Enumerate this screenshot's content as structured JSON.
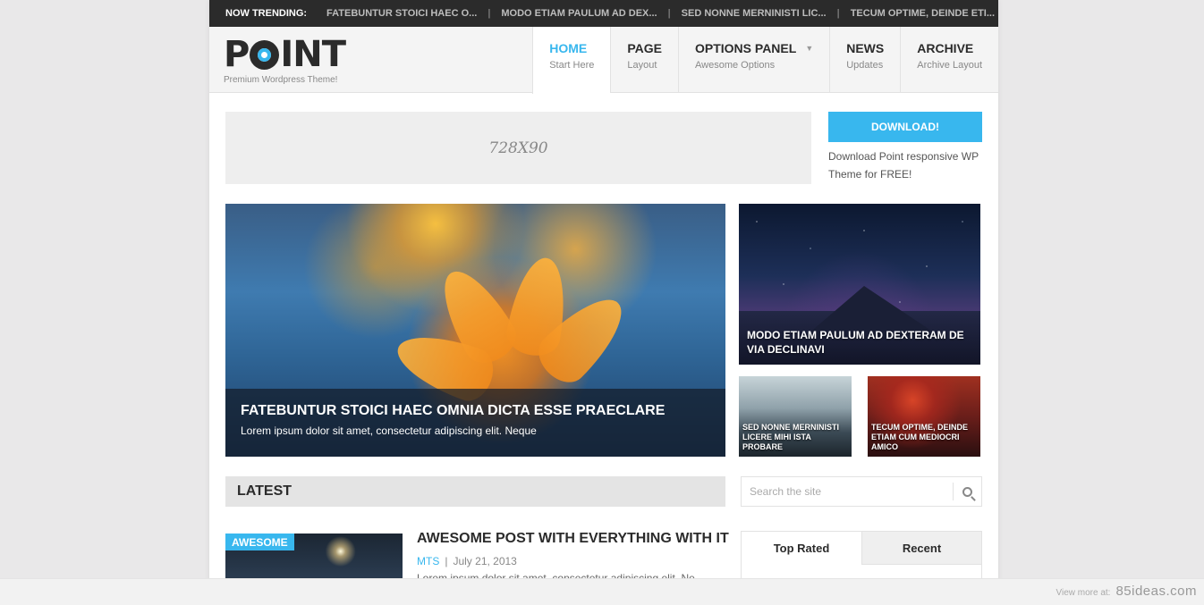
{
  "trending": {
    "label": "NOW TRENDING:",
    "items": [
      "FATEBUNTUR STOICI HAEC O...",
      "MODO ETIAM PAULUM AD DEX...",
      "SED NONNE MERNINISTI LIC...",
      "TECUM OPTIME, DEINDE ETI..."
    ]
  },
  "logo": {
    "text_pre": "P",
    "text_post": "INT",
    "tagline": "Premium Wordpress Theme!"
  },
  "nav": [
    {
      "title": "HOME",
      "sub": "Start Here",
      "active": true
    },
    {
      "title": "PAGE",
      "sub": "Layout"
    },
    {
      "title": "OPTIONS PANEL",
      "sub": "Awesome Options",
      "dropdown": true
    },
    {
      "title": "NEWS",
      "sub": "Updates"
    },
    {
      "title": "ARCHIVE",
      "sub": "Archive Layout"
    }
  ],
  "ad": {
    "label": "728X90"
  },
  "download": {
    "button": "DOWNLOAD!",
    "text": "Download Point responsive WP Theme for FREE!"
  },
  "featured": {
    "main": {
      "title": "FATEBUNTUR STOICI HAEC OMNIA DICTA ESSE PRAECLARE",
      "excerpt": "Lorem ipsum dolor sit amet, consectetur adipiscing elit. Neque"
    },
    "right_top": {
      "title": "MODO ETIAM PAULUM AD DEXTERAM DE VIA DECLINAVI"
    },
    "right_bottom_left": {
      "title": "SED NONNE MERNINISTI LICERE MIHI ISTA PROBARE"
    },
    "right_bottom_right": {
      "title": "TECUM OPTIME, DEINDE ETIAM CUM MEDIOCRI AMICO"
    }
  },
  "latest": {
    "heading": "LATEST"
  },
  "search": {
    "placeholder": "Search the site"
  },
  "post": {
    "badge": "AWESOME",
    "title": "AWESOME POST WITH EVERYTHING WITH IT",
    "author": "MTS",
    "date": "July 21, 2013",
    "excerpt": "Lorem ipsum dolor sit amet, consectetur adipiscing elit. Ne"
  },
  "tabs": {
    "top_rated": "Top Rated",
    "recent": "Recent"
  },
  "footer": {
    "view_more": "View more at:",
    "site": "85ideas.com"
  },
  "colors": {
    "accent": "#38b7ee",
    "dark": "#2b2b2b"
  }
}
